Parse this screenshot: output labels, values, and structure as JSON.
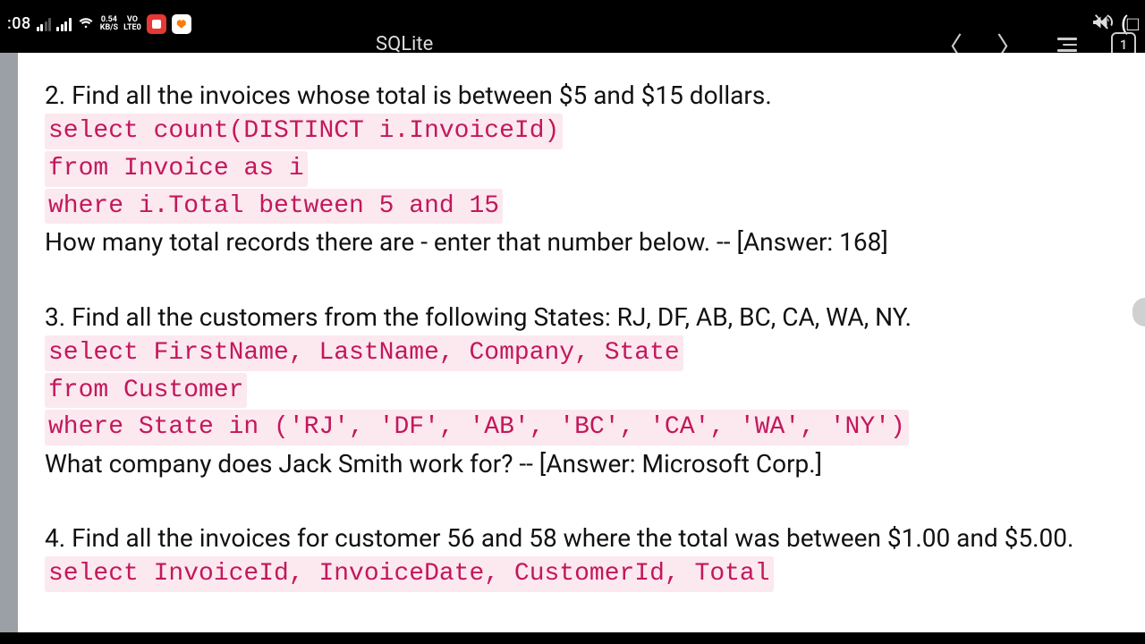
{
  "statusbar": {
    "time": ":08",
    "net_speed_top": "0.54",
    "net_speed_bottom": "KB/S",
    "vo_top": "VO",
    "vo_bottom": "LTE0"
  },
  "navbar": {
    "title": "SQLite",
    "tab_count": "1"
  },
  "content": {
    "q2": {
      "prompt": "2. Find all the invoices whose total is between $5 and $15 dollars.",
      "code": [
        "select count(DISTINCT i.InvoiceId)",
        "from Invoice as i",
        "where i.Total between 5 and 15"
      ],
      "answer": "How many total records there are - enter that number below. -- [Answer: 168]"
    },
    "q3": {
      "prompt": "3. Find all the customers from the following States: RJ, DF, AB, BC, CA, WA, NY.",
      "code": [
        "select FirstName, LastName, Company, State",
        "from Customer",
        "where State in ('RJ', 'DF', 'AB', 'BC', 'CA', 'WA', 'NY')"
      ],
      "answer": "What company does Jack Smith work for? -- [Answer: Microsoft Corp.]"
    },
    "q4": {
      "prompt": "4. Find all the invoices for customer 56 and 58 where the total was between $1.00 and $5.00.",
      "code": [
        "select InvoiceId, InvoiceDate, CustomerId, Total"
      ]
    }
  }
}
